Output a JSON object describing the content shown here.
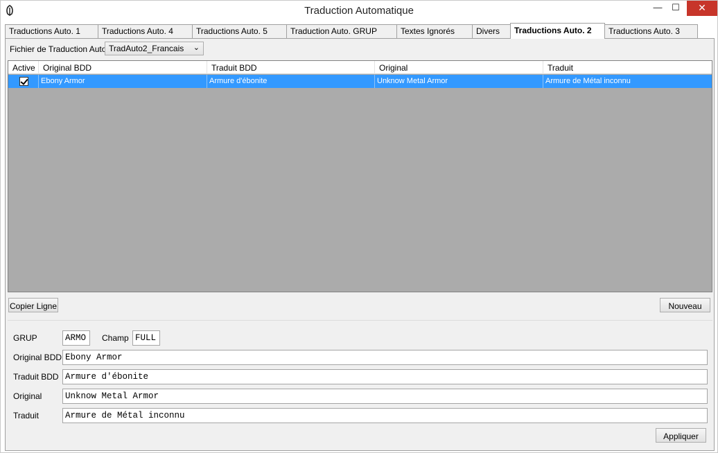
{
  "window": {
    "title": "Traduction Automatique",
    "minimize_glyph": "—",
    "maximize_glyph": "☐",
    "close_glyph": "✕"
  },
  "tabs": [
    {
      "label": "Traductions Auto. 1",
      "active": false
    },
    {
      "label": "Traductions Auto. 4",
      "active": false
    },
    {
      "label": "Traductions Auto. 5",
      "active": false
    },
    {
      "label": "Traduction Auto. GRUP",
      "active": false
    },
    {
      "label": "Textes Ignorés",
      "active": false
    },
    {
      "label": "Divers",
      "active": false
    },
    {
      "label": "Traductions Auto. 2",
      "active": true
    },
    {
      "label": "Traductions Auto. 3",
      "active": false
    }
  ],
  "file": {
    "label": "Fichier de Traduction Auto.",
    "selected": "TradAuto2_Francais",
    "chevron": "⌄"
  },
  "grid": {
    "columns": [
      "Active",
      "Original BDD",
      "Traduit BDD",
      "Original",
      "Traduit"
    ],
    "rows": [
      {
        "active": true,
        "original_bdd": "Ebony Armor",
        "traduit_bdd": "Armure d'ébonite",
        "original": "Unknow Metal Armor",
        "traduit": "Armure de Métal inconnu"
      }
    ]
  },
  "buttons": {
    "copy_line": "Copier Ligne",
    "new": "Nouveau",
    "apply": "Appliquer"
  },
  "form": {
    "grup_label": "GRUP",
    "grup_value": "ARMO",
    "champ_label": "Champ",
    "champ_value": "FULL",
    "original_bdd_label": "Original BDD",
    "original_bdd_value": "Ebony Armor",
    "traduit_bdd_label": "Traduit BDD",
    "traduit_bdd_value": "Armure d'ébonite",
    "original_label": "Original",
    "original_value": "Unknow Metal Armor",
    "traduit_label": "Traduit",
    "traduit_value": "Armure de Métal inconnu"
  },
  "colors": {
    "selection": "#3399ff",
    "grid_background": "#ababab",
    "close_button": "#c7352a"
  },
  "icons": {
    "app": "feather-icon",
    "checkbox": "checkmark-icon"
  }
}
